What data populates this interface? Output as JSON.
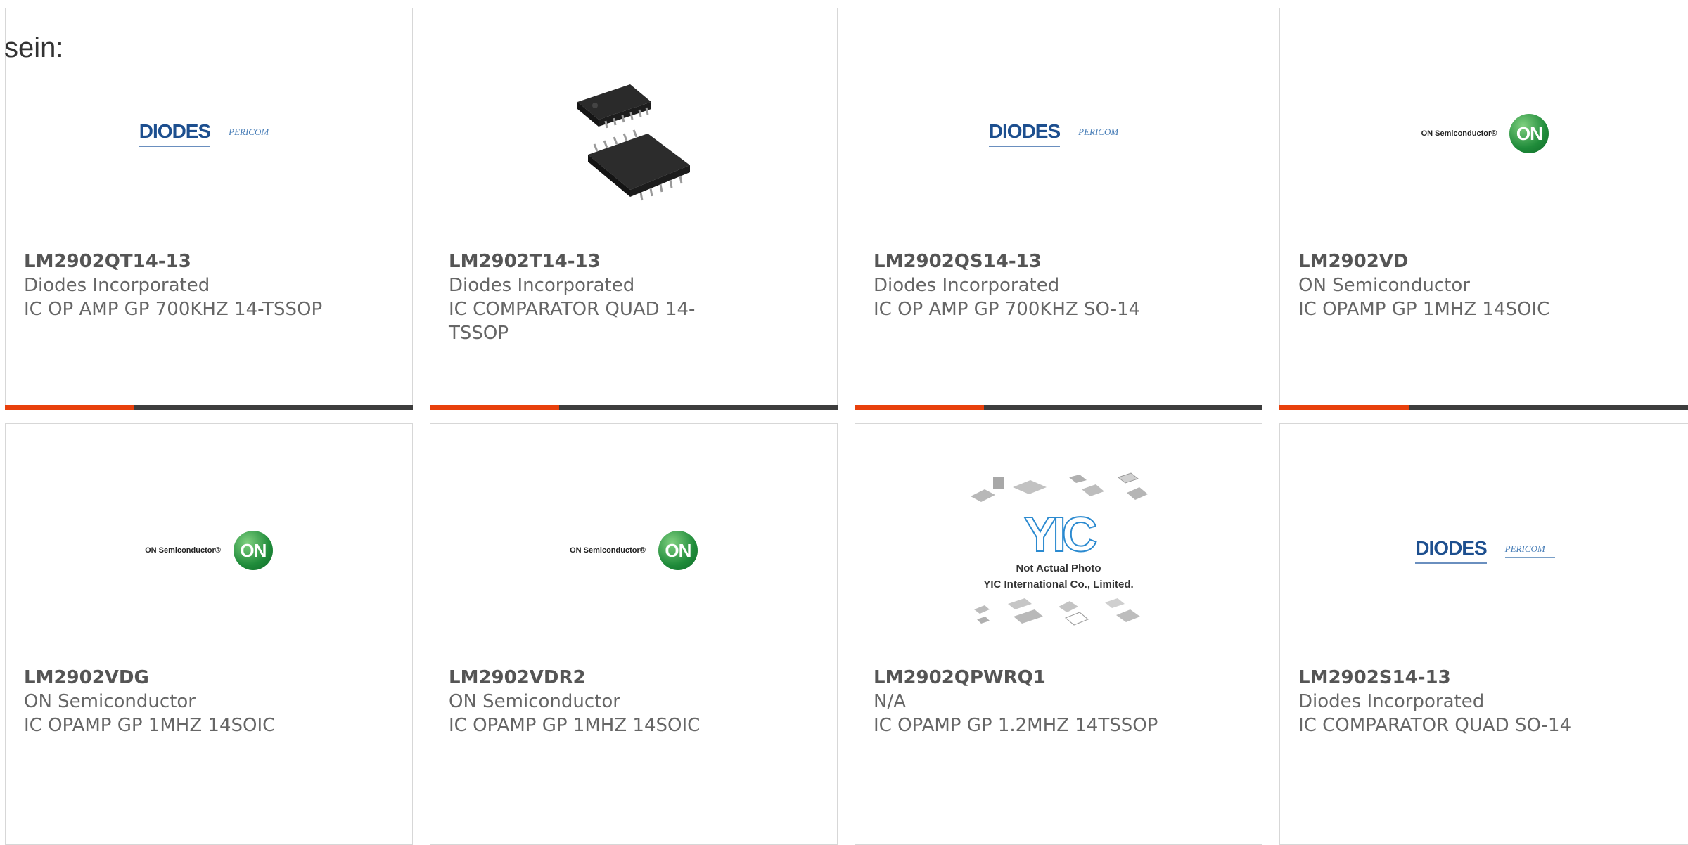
{
  "intro_text": "sein:",
  "colors": {
    "accent_red": "#e8400c",
    "accent_dark": "#3d3d3d"
  },
  "products": [
    {
      "part_number": "LM2902QT14-13",
      "manufacturer": "Diodes Incorporated",
      "description": "IC OP AMP GP 700KHZ 14-TSSOP",
      "image": "diodes-pericom-logo"
    },
    {
      "part_number": "LM2902T14-13",
      "manufacturer": "Diodes Incorporated",
      "description": "IC COMPARATOR QUAD 14-TSSOP",
      "image": "tssop-chip-photo"
    },
    {
      "part_number": "LM2902QS14-13",
      "manufacturer": "Diodes Incorporated",
      "description": "IC OP AMP GP 700KHZ SO-14",
      "image": "diodes-pericom-logo"
    },
    {
      "part_number": "LM2902VD",
      "manufacturer": "ON Semiconductor",
      "description": "IC OPAMP GP 1MHZ 14SOIC",
      "image": "on-semiconductor-logo"
    },
    {
      "part_number": "LM2902VDG",
      "manufacturer": "ON Semiconductor",
      "description": "IC OPAMP GP 1MHZ 14SOIC",
      "image": "on-semiconductor-logo"
    },
    {
      "part_number": "LM2902VDR2",
      "manufacturer": "ON Semiconductor",
      "description": "IC OPAMP GP 1MHZ 14SOIC",
      "image": "on-semiconductor-logo"
    },
    {
      "part_number": "LM2902QPWRQ1",
      "manufacturer": "N/A",
      "description": "IC OPAMP GP 1.2MHZ 14TSSOP",
      "image": "yic-placeholder"
    },
    {
      "part_number": "LM2902S14-13",
      "manufacturer": "Diodes Incorporated",
      "description": "IC COMPARATOR QUAD SO-14",
      "image": "diodes-pericom-logo"
    }
  ],
  "logos": {
    "diodes_word": "DIODES",
    "pericom_word": "PERICOM",
    "on_text": "ON Semiconductor®",
    "on_badge": "ON",
    "yic_mark": "YIC",
    "yic_caption_1": "Not Actual Photo",
    "yic_caption_2": "YIC International Co., Limited."
  }
}
